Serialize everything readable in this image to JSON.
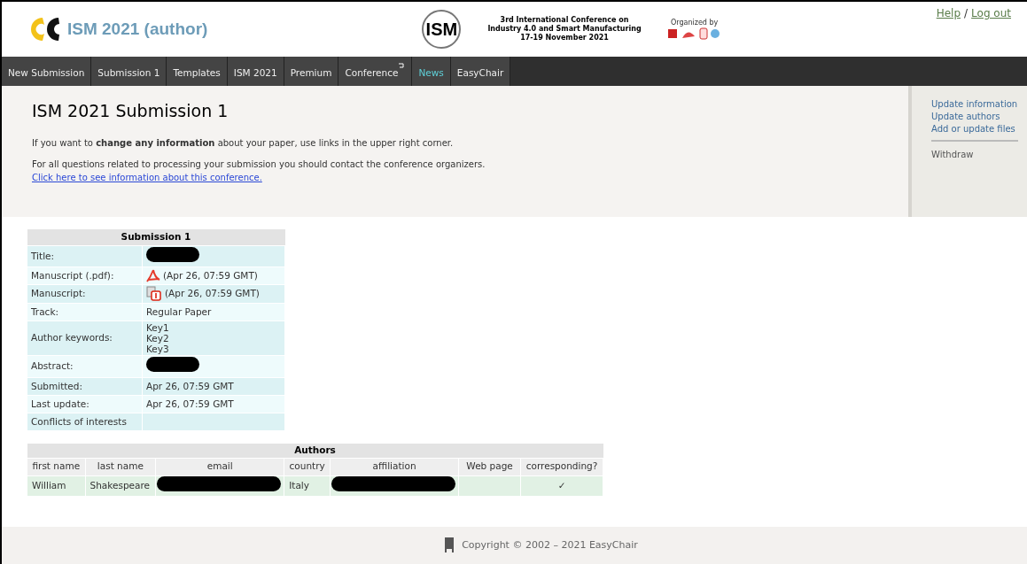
{
  "header": {
    "title": "ISM 2021 (author)",
    "logo_text": "ISM",
    "conference_lines": [
      "3rd International Conference on",
      "Industry 4.0 and Smart Manufacturing",
      "17-19 November 2021"
    ],
    "organized_by": "Organized by",
    "links": [
      "Help",
      "Log out"
    ],
    "link_separator": "/"
  },
  "nav": [
    {
      "label": "New Submission",
      "selected": false,
      "return_icon": false
    },
    {
      "label": "Submission 1",
      "selected": false,
      "return_icon": false
    },
    {
      "label": "Templates",
      "selected": false,
      "return_icon": false
    },
    {
      "label": "ISM 2021",
      "selected": false,
      "return_icon": false
    },
    {
      "label": "Premium",
      "selected": false,
      "return_icon": false
    },
    {
      "label": "Conference",
      "selected": false,
      "return_icon": true
    },
    {
      "label": "News",
      "selected": true,
      "return_icon": false
    },
    {
      "label": "EasyChair",
      "selected": false,
      "return_icon": false
    }
  ],
  "page": {
    "heading": "ISM 2021 Submission 1",
    "intro": "If you want to **change any information** about your paper, use links in the upper right corner.",
    "contact": "For all questions related to processing your submission you should contact the conference organizers.",
    "contact_link": "Click here to see information about this conference."
  },
  "side_menu": {
    "groups": [
      [
        "Update information",
        "Update authors",
        "Add or update files"
      ],
      [
        "Withdraw"
      ]
    ]
  },
  "submission_table": {
    "title": "Submission 1",
    "rows": [
      {
        "label": "Title:",
        "kind": "redacted"
      },
      {
        "label": "Manuscript (.pdf):",
        "kind": "pdf",
        "text": "(Apr 26, 07:59 GMT)"
      },
      {
        "label": "Manuscript:",
        "kind": "file",
        "text": "(Apr 26, 07:59 GMT)"
      },
      {
        "label": "Track:",
        "kind": "text",
        "text": "Regular Paper"
      },
      {
        "label": "Author keywords:",
        "kind": "lines",
        "lines": [
          "Key1",
          "Key2",
          "Key3"
        ]
      },
      {
        "label": "Abstract:",
        "kind": "redacted"
      },
      {
        "label": "Submitted:",
        "kind": "text",
        "text": "Apr 26, 07:59 GMT"
      },
      {
        "label": "Last update:",
        "kind": "text",
        "text": "Apr 26, 07:59 GMT"
      },
      {
        "label": "Conflicts of interests",
        "kind": "empty"
      }
    ]
  },
  "authors_table": {
    "title": "Authors",
    "columns": [
      "first name",
      "last name",
      "email",
      "country",
      "affiliation",
      "Web page",
      "corresponding?"
    ],
    "rows": [
      {
        "cells": [
          {
            "kind": "text",
            "text": "William"
          },
          {
            "kind": "text",
            "text": "Shakespeare"
          },
          {
            "kind": "redacted"
          },
          {
            "kind": "text",
            "text": "Italy"
          },
          {
            "kind": "redacted"
          },
          {
            "kind": "empty"
          },
          {
            "kind": "check",
            "text": "✓"
          }
        ]
      }
    ]
  },
  "footer": {
    "copyright": "Copyright © 2002 – 2021 EasyChair"
  }
}
